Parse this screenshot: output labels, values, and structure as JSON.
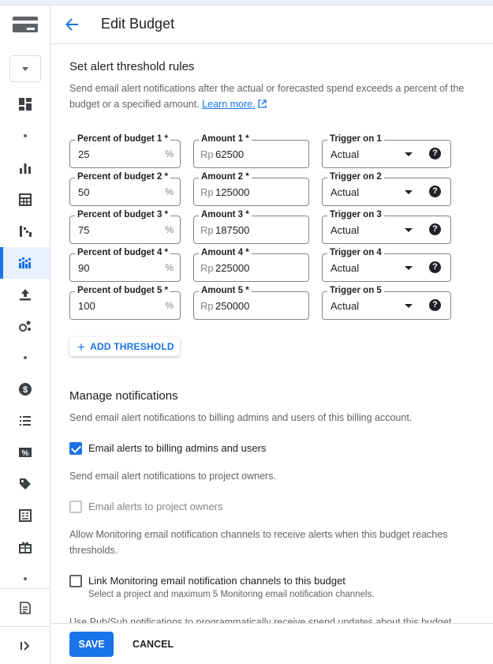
{
  "header": {
    "title": "Edit Budget",
    "back_icon": "arrow-back-icon"
  },
  "sidebar": {
    "items": [
      {
        "icon": "dashboard-icon"
      },
      {
        "icon": "dot-icon"
      },
      {
        "icon": "bar-chart-icon"
      },
      {
        "icon": "calculator-icon"
      },
      {
        "icon": "trend-icon"
      },
      {
        "icon": "budgets-icon",
        "active": true
      },
      {
        "icon": "upload-icon"
      },
      {
        "icon": "bubbles-icon"
      },
      {
        "icon": "dot-icon"
      },
      {
        "icon": "dollar-icon"
      },
      {
        "icon": "list-icon"
      },
      {
        "icon": "percent-icon"
      },
      {
        "icon": "tag-icon"
      },
      {
        "icon": "ledger-icon"
      },
      {
        "icon": "gift-icon"
      },
      {
        "icon": "dot-icon"
      },
      {
        "icon": "release-notes-icon"
      },
      {
        "icon": "expand-icon"
      }
    ]
  },
  "thresholds": {
    "title": "Set alert threshold rules",
    "description": "Send email alert notifications after the actual or forecasted spend exceeds a percent of the budget or a specified amount.",
    "learn_more": "Learn more.",
    "percent_suffix": "%",
    "currency_prefix": "Rp",
    "rows": [
      {
        "percent_label": "Percent of budget 1 *",
        "percent": "25",
        "amount_label": "Amount 1 *",
        "amount": "62500",
        "trigger_label": "Trigger on 1",
        "trigger": "Actual"
      },
      {
        "percent_label": "Percent of budget 2 *",
        "percent": "50",
        "amount_label": "Amount 2 *",
        "amount": "125000",
        "trigger_label": "Trigger on 2",
        "trigger": "Actual"
      },
      {
        "percent_label": "Percent of budget 3 *",
        "percent": "75",
        "amount_label": "Amount 3 *",
        "amount": "187500",
        "trigger_label": "Trigger on 3",
        "trigger": "Actual"
      },
      {
        "percent_label": "Percent of budget 4 *",
        "percent": "90",
        "amount_label": "Amount 4 *",
        "amount": "225000",
        "trigger_label": "Trigger on 4",
        "trigger": "Actual"
      },
      {
        "percent_label": "Percent of budget 5 *",
        "percent": "100",
        "amount_label": "Amount 5 *",
        "amount": "250000",
        "trigger_label": "Trigger on 5",
        "trigger": "Actual"
      }
    ],
    "add_threshold": "ADD THRESHOLD"
  },
  "notifications": {
    "title": "Manage notifications",
    "admins_description": "Send email alert notifications to billing admins and users of this billing account.",
    "admins_checkbox": "Email alerts to billing admins and users",
    "admins_checked": true,
    "owners_description": "Send email alert notifications to project owners.",
    "owners_checkbox": "Email alerts to project owners",
    "owners_disabled": true,
    "monitoring_description": "Allow Monitoring email notification channels to receive alerts when this budget reaches thresholds.",
    "monitoring_checkbox": "Link Monitoring email notification channels to this budget",
    "monitoring_sub": "Select a project and maximum 5 Monitoring email notification channels.",
    "pubsub_description": "Use Pub/Sub notifications to programmatically receive spend updates about this budget"
  },
  "footer": {
    "save": "SAVE",
    "cancel": "CANCEL"
  },
  "colors": {
    "accent": "#1a73e8",
    "active_bg": "#e8f0fe"
  }
}
